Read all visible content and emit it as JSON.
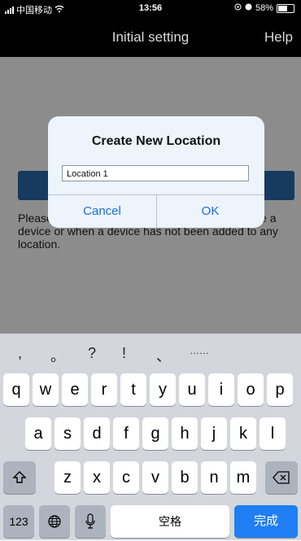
{
  "status_bar": {
    "carrier": "中国移动",
    "time": "13:56",
    "battery": "58%"
  },
  "nav": {
    "title": "Initial setting",
    "help": "Help"
  },
  "hint_text": "Please add a new location for the first time to use a device or when a device has not been added to any location.",
  "dialog": {
    "title": "Create New Location",
    "input_value": "Location 1",
    "cancel": "Cancel",
    "ok": "OK"
  },
  "keyboard": {
    "punct_row": [
      ",",
      "。",
      "?",
      "!",
      "、",
      "……"
    ],
    "row1": [
      "q",
      "w",
      "e",
      "r",
      "t",
      "y",
      "u",
      "i",
      "o",
      "p"
    ],
    "row2": [
      "a",
      "s",
      "d",
      "f",
      "g",
      "h",
      "j",
      "k",
      "l"
    ],
    "row3": [
      "z",
      "x",
      "c",
      "v",
      "b",
      "n",
      "m"
    ],
    "num_key": "123",
    "space": "空格",
    "done": "完成"
  },
  "icons": [
    "signal-icon",
    "wifi-icon",
    "location-icon",
    "alarm-icon",
    "battery-icon",
    "shift-icon",
    "delete-icon",
    "globe-icon",
    "microphone-icon"
  ]
}
